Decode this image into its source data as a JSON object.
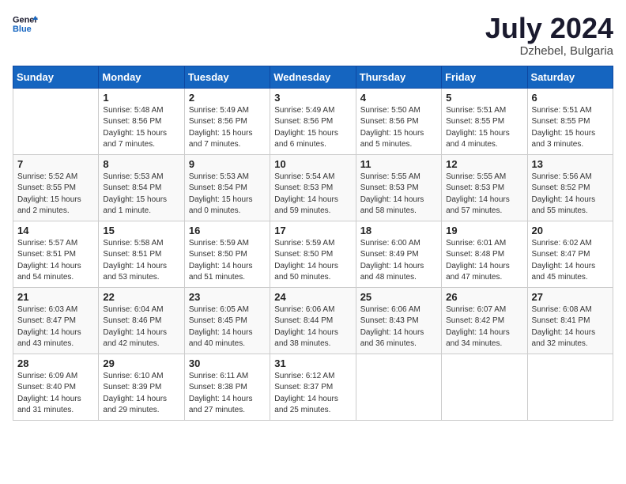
{
  "header": {
    "logo_line1": "General",
    "logo_line2": "Blue",
    "month": "July 2024",
    "location": "Dzhebel, Bulgaria"
  },
  "days_of_week": [
    "Sunday",
    "Monday",
    "Tuesday",
    "Wednesday",
    "Thursday",
    "Friday",
    "Saturday"
  ],
  "weeks": [
    [
      {
        "day": "",
        "sunrise": "",
        "sunset": "",
        "daylight": ""
      },
      {
        "day": "1",
        "sunrise": "Sunrise: 5:48 AM",
        "sunset": "Sunset: 8:56 PM",
        "daylight": "Daylight: 15 hours and 7 minutes."
      },
      {
        "day": "2",
        "sunrise": "Sunrise: 5:49 AM",
        "sunset": "Sunset: 8:56 PM",
        "daylight": "Daylight: 15 hours and 7 minutes."
      },
      {
        "day": "3",
        "sunrise": "Sunrise: 5:49 AM",
        "sunset": "Sunset: 8:56 PM",
        "daylight": "Daylight: 15 hours and 6 minutes."
      },
      {
        "day": "4",
        "sunrise": "Sunrise: 5:50 AM",
        "sunset": "Sunset: 8:56 PM",
        "daylight": "Daylight: 15 hours and 5 minutes."
      },
      {
        "day": "5",
        "sunrise": "Sunrise: 5:51 AM",
        "sunset": "Sunset: 8:55 PM",
        "daylight": "Daylight: 15 hours and 4 minutes."
      },
      {
        "day": "6",
        "sunrise": "Sunrise: 5:51 AM",
        "sunset": "Sunset: 8:55 PM",
        "daylight": "Daylight: 15 hours and 3 minutes."
      }
    ],
    [
      {
        "day": "7",
        "sunrise": "Sunrise: 5:52 AM",
        "sunset": "Sunset: 8:55 PM",
        "daylight": "Daylight: 15 hours and 2 minutes."
      },
      {
        "day": "8",
        "sunrise": "Sunrise: 5:53 AM",
        "sunset": "Sunset: 8:54 PM",
        "daylight": "Daylight: 15 hours and 1 minute."
      },
      {
        "day": "9",
        "sunrise": "Sunrise: 5:53 AM",
        "sunset": "Sunset: 8:54 PM",
        "daylight": "Daylight: 15 hours and 0 minutes."
      },
      {
        "day": "10",
        "sunrise": "Sunrise: 5:54 AM",
        "sunset": "Sunset: 8:53 PM",
        "daylight": "Daylight: 14 hours and 59 minutes."
      },
      {
        "day": "11",
        "sunrise": "Sunrise: 5:55 AM",
        "sunset": "Sunset: 8:53 PM",
        "daylight": "Daylight: 14 hours and 58 minutes."
      },
      {
        "day": "12",
        "sunrise": "Sunrise: 5:55 AM",
        "sunset": "Sunset: 8:53 PM",
        "daylight": "Daylight: 14 hours and 57 minutes."
      },
      {
        "day": "13",
        "sunrise": "Sunrise: 5:56 AM",
        "sunset": "Sunset: 8:52 PM",
        "daylight": "Daylight: 14 hours and 55 minutes."
      }
    ],
    [
      {
        "day": "14",
        "sunrise": "Sunrise: 5:57 AM",
        "sunset": "Sunset: 8:51 PM",
        "daylight": "Daylight: 14 hours and 54 minutes."
      },
      {
        "day": "15",
        "sunrise": "Sunrise: 5:58 AM",
        "sunset": "Sunset: 8:51 PM",
        "daylight": "Daylight: 14 hours and 53 minutes."
      },
      {
        "day": "16",
        "sunrise": "Sunrise: 5:59 AM",
        "sunset": "Sunset: 8:50 PM",
        "daylight": "Daylight: 14 hours and 51 minutes."
      },
      {
        "day": "17",
        "sunrise": "Sunrise: 5:59 AM",
        "sunset": "Sunset: 8:50 PM",
        "daylight": "Daylight: 14 hours and 50 minutes."
      },
      {
        "day": "18",
        "sunrise": "Sunrise: 6:00 AM",
        "sunset": "Sunset: 8:49 PM",
        "daylight": "Daylight: 14 hours and 48 minutes."
      },
      {
        "day": "19",
        "sunrise": "Sunrise: 6:01 AM",
        "sunset": "Sunset: 8:48 PM",
        "daylight": "Daylight: 14 hours and 47 minutes."
      },
      {
        "day": "20",
        "sunrise": "Sunrise: 6:02 AM",
        "sunset": "Sunset: 8:47 PM",
        "daylight": "Daylight: 14 hours and 45 minutes."
      }
    ],
    [
      {
        "day": "21",
        "sunrise": "Sunrise: 6:03 AM",
        "sunset": "Sunset: 8:47 PM",
        "daylight": "Daylight: 14 hours and 43 minutes."
      },
      {
        "day": "22",
        "sunrise": "Sunrise: 6:04 AM",
        "sunset": "Sunset: 8:46 PM",
        "daylight": "Daylight: 14 hours and 42 minutes."
      },
      {
        "day": "23",
        "sunrise": "Sunrise: 6:05 AM",
        "sunset": "Sunset: 8:45 PM",
        "daylight": "Daylight: 14 hours and 40 minutes."
      },
      {
        "day": "24",
        "sunrise": "Sunrise: 6:06 AM",
        "sunset": "Sunset: 8:44 PM",
        "daylight": "Daylight: 14 hours and 38 minutes."
      },
      {
        "day": "25",
        "sunrise": "Sunrise: 6:06 AM",
        "sunset": "Sunset: 8:43 PM",
        "daylight": "Daylight: 14 hours and 36 minutes."
      },
      {
        "day": "26",
        "sunrise": "Sunrise: 6:07 AM",
        "sunset": "Sunset: 8:42 PM",
        "daylight": "Daylight: 14 hours and 34 minutes."
      },
      {
        "day": "27",
        "sunrise": "Sunrise: 6:08 AM",
        "sunset": "Sunset: 8:41 PM",
        "daylight": "Daylight: 14 hours and 32 minutes."
      }
    ],
    [
      {
        "day": "28",
        "sunrise": "Sunrise: 6:09 AM",
        "sunset": "Sunset: 8:40 PM",
        "daylight": "Daylight: 14 hours and 31 minutes."
      },
      {
        "day": "29",
        "sunrise": "Sunrise: 6:10 AM",
        "sunset": "Sunset: 8:39 PM",
        "daylight": "Daylight: 14 hours and 29 minutes."
      },
      {
        "day": "30",
        "sunrise": "Sunrise: 6:11 AM",
        "sunset": "Sunset: 8:38 PM",
        "daylight": "Daylight: 14 hours and 27 minutes."
      },
      {
        "day": "31",
        "sunrise": "Sunrise: 6:12 AM",
        "sunset": "Sunset: 8:37 PM",
        "daylight": "Daylight: 14 hours and 25 minutes."
      },
      {
        "day": "",
        "sunrise": "",
        "sunset": "",
        "daylight": ""
      },
      {
        "day": "",
        "sunrise": "",
        "sunset": "",
        "daylight": ""
      },
      {
        "day": "",
        "sunrise": "",
        "sunset": "",
        "daylight": ""
      }
    ]
  ]
}
